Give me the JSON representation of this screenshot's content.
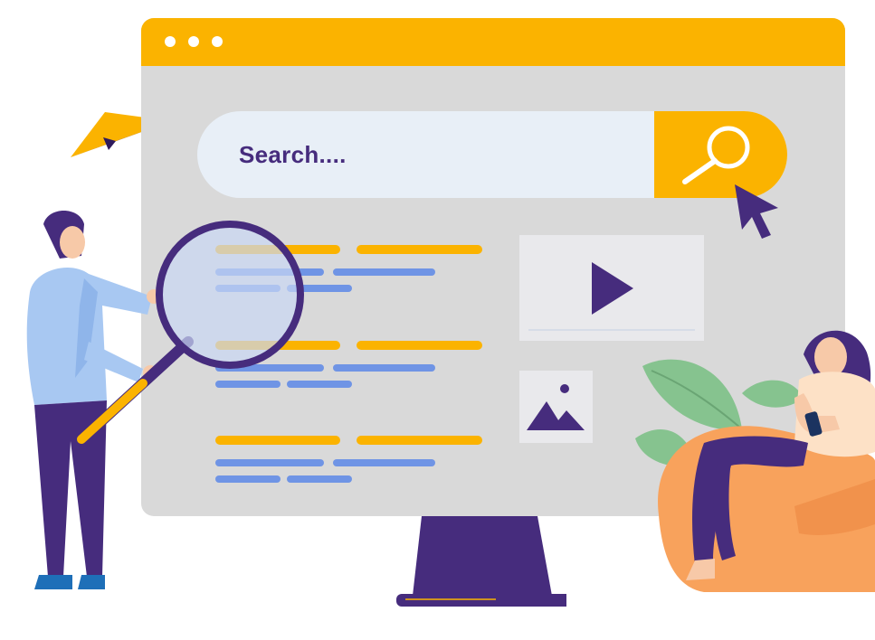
{
  "search": {
    "placeholder": "Search...."
  },
  "colors": {
    "accent": "#fbb300",
    "primary_purple": "#462c7d",
    "screen_bg": "#d9d9d9",
    "result_blue": "#6f94e5",
    "search_field": "#e8eff7"
  },
  "results": [
    {
      "title_lines": 2,
      "snippet_lines": 4
    },
    {
      "title_lines": 2,
      "snippet_lines": 4
    },
    {
      "title_lines": 2,
      "snippet_lines": 4
    }
  ],
  "icons": [
    "search-icon",
    "cursor-icon",
    "play-icon",
    "image-icon",
    "magnifying-glass",
    "paper-plane-icon",
    "smartphone-icon"
  ]
}
